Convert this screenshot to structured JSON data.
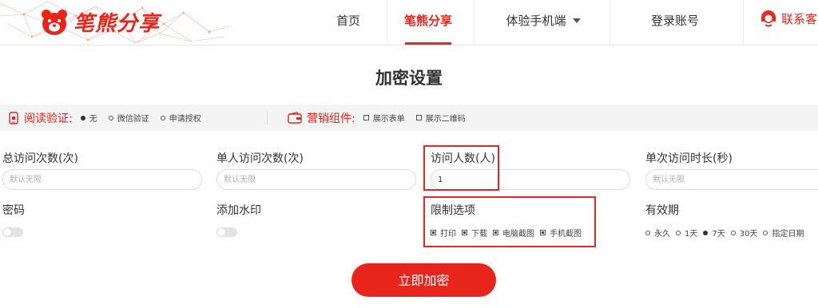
{
  "brand": {
    "name": "笔熊分享",
    "color": "#e8251c"
  },
  "nav": {
    "items": [
      "首页",
      "笔熊分享",
      "体验手机端",
      "登录账号"
    ],
    "active_index": 1,
    "contact": "联系客"
  },
  "page": {
    "title": "加密设置"
  },
  "options": {
    "read_verify": {
      "label": "阅读验证:",
      "icon": "phone-lock-icon",
      "choices": [
        "无",
        "微信验证",
        "申请授权"
      ],
      "selected": 0
    },
    "marketing": {
      "label": "营销组件:",
      "icon": "wallet-icon",
      "choices": [
        "展示表单",
        "展示二维码"
      ]
    }
  },
  "fields": {
    "total_visits": {
      "label": "总访问次数(次)",
      "placeholder": "默认无限",
      "value": ""
    },
    "single_visits": {
      "label": "单人访问次数(次)",
      "placeholder": "默认无限",
      "value": ""
    },
    "visitors": {
      "label": "访问人数(人)",
      "placeholder": "",
      "value": "1"
    },
    "duration": {
      "label": "单次访问时长(秒)",
      "placeholder": "默认无限",
      "value": ""
    },
    "password": {
      "label": "密码"
    },
    "watermark": {
      "label": "添加水印"
    },
    "restrict": {
      "label": "限制选项",
      "choices": [
        "打印",
        "下载",
        "电脑截图",
        "手机截图"
      ]
    },
    "validity": {
      "label": "有效期",
      "choices": [
        "永久",
        "1天",
        "7天",
        "30天",
        "指定日期"
      ],
      "selected": 2
    }
  },
  "submit_label": "立即加密",
  "colors": {
    "accent": "#e8251c",
    "highlight_box": "#e0262b",
    "bar_bg": "#f4f4f4"
  }
}
